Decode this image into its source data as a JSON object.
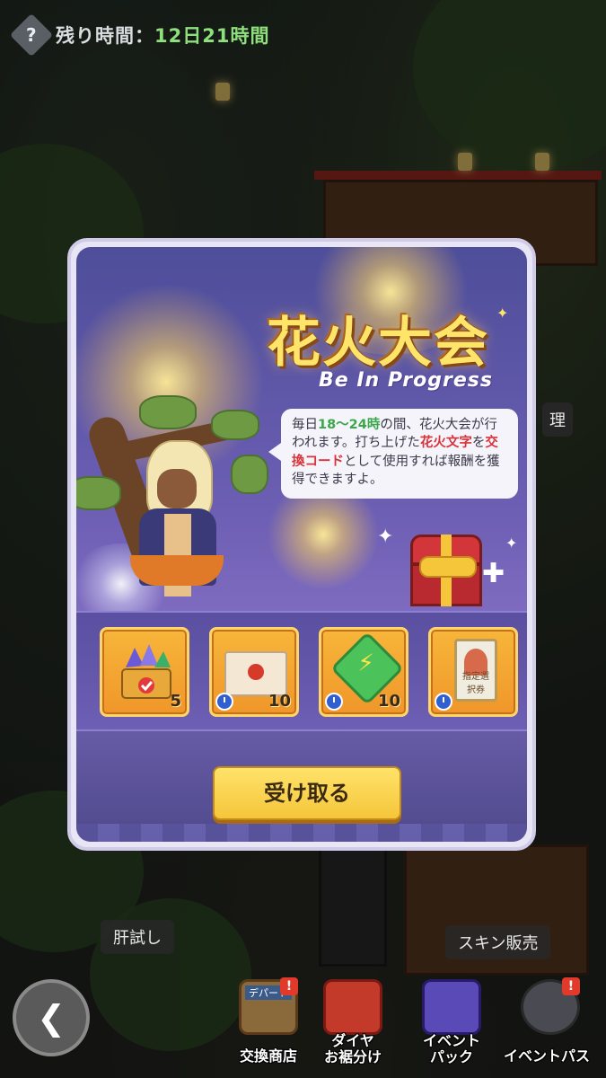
{
  "timer": {
    "label": "残り時間：",
    "value": "12日21時間"
  },
  "popup": {
    "title": "花火大会",
    "subtitle": "Be In Progress",
    "description": {
      "part1": "毎日",
      "hours": "18〜24時",
      "part2": "の間、花火大会が行われます。打ち上げた",
      "word1": "花火文字",
      "part3": "を",
      "word2": "交換コード",
      "part4": "として使用すれば報酬を獲得できますよ。"
    },
    "rewards": [
      {
        "icon": "gem-chest-icon",
        "count": "5"
      },
      {
        "icon": "sealed-letter-icon",
        "count": "10"
      },
      {
        "icon": "energy-crystal-icon",
        "count": "10"
      },
      {
        "icon": "selection-ticket-icon",
        "count": "",
        "card_label": "指定選択券"
      }
    ],
    "claim_button": "受け取る"
  },
  "map_labels": {
    "test_of_courage": "肝試し",
    "skin_shop": "スキン販売",
    "partial_label": "理"
  },
  "bottom_nav": {
    "exchange_shop": {
      "label": "交換商店",
      "sign": "デパート",
      "badge": "!"
    },
    "diamond_share": {
      "label": "ダイヤ\nお裾分け"
    },
    "event_pack": {
      "label": "イベント\nパック"
    },
    "event_pass": {
      "label": "イベントパス",
      "badge": "!"
    }
  },
  "colors": {
    "accent_gold": "#f5c63a",
    "title_yellow": "#ffe46a",
    "timer_green": "#8fe07c",
    "popup_purple": "#6d5fb4"
  }
}
